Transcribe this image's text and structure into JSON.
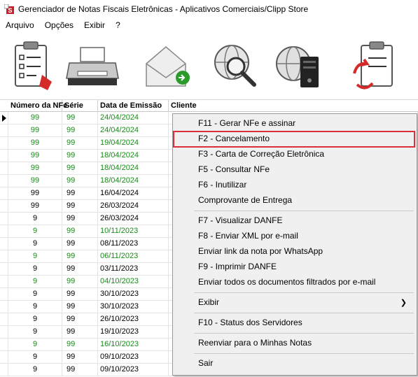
{
  "window": {
    "title": "Gerenciador de Notas Fiscais Eletrônicas - Aplicativos Comerciais/Clipp Store"
  },
  "menu": [
    "Arquivo",
    "Opções",
    "Exibir",
    "?"
  ],
  "toolbar": {
    "icons": [
      "clipboard-icon",
      "printer-icon",
      "envelope-icon",
      "globe-search-icon",
      "globe-server-icon",
      "clipboard-refresh-icon"
    ]
  },
  "grid": {
    "headers": [
      "Número da NFe",
      "Série",
      "Data de Emissão",
      "Cliente"
    ],
    "rows": [
      {
        "numero": "99",
        "serie": "99",
        "data": "24/04/2024",
        "color": "green"
      },
      {
        "numero": "99",
        "serie": "99",
        "data": "24/04/2024",
        "color": "green"
      },
      {
        "numero": "99",
        "serie": "99",
        "data": "19/04/2024",
        "color": "green"
      },
      {
        "numero": "99",
        "serie": "99",
        "data": "18/04/2024",
        "color": "green"
      },
      {
        "numero": "99",
        "serie": "99",
        "data": "18/04/2024",
        "color": "green"
      },
      {
        "numero": "99",
        "serie": "99",
        "data": "18/04/2024",
        "color": "green"
      },
      {
        "numero": "99",
        "serie": "99",
        "data": "16/04/2024",
        "color": "black"
      },
      {
        "numero": "99",
        "serie": "99",
        "data": "26/03/2024",
        "color": "black"
      },
      {
        "numero": "9",
        "serie": "99",
        "data": "26/03/2024",
        "color": "black"
      },
      {
        "numero": "9",
        "serie": "99",
        "data": "10/11/2023",
        "color": "green"
      },
      {
        "numero": "9",
        "serie": "99",
        "data": "08/11/2023",
        "color": "black"
      },
      {
        "numero": "9",
        "serie": "99",
        "data": "06/11/2023",
        "color": "green"
      },
      {
        "numero": "9",
        "serie": "99",
        "data": "03/11/2023",
        "color": "black"
      },
      {
        "numero": "9",
        "serie": "99",
        "data": "04/10/2023",
        "color": "green"
      },
      {
        "numero": "9",
        "serie": "99",
        "data": "30/10/2023",
        "color": "black"
      },
      {
        "numero": "9",
        "serie": "99",
        "data": "30/10/2023",
        "color": "black"
      },
      {
        "numero": "9",
        "serie": "99",
        "data": "26/10/2023",
        "color": "black"
      },
      {
        "numero": "9",
        "serie": "99",
        "data": "19/10/2023",
        "color": "black"
      },
      {
        "numero": "9",
        "serie": "99",
        "data": "16/10/2023",
        "color": "green"
      },
      {
        "numero": "9",
        "serie": "99",
        "data": "09/10/2023",
        "color": "black"
      },
      {
        "numero": "9",
        "serie": "99",
        "data": "09/10/2023",
        "color": "black"
      }
    ]
  },
  "context_menu": {
    "items": [
      "F11 - Gerar NFe e assinar",
      "F2 - Cancelamento",
      "F3 - Carta de Correção Eletrônica",
      "F5 - Consultar NFe",
      "F6 - Inutilizar",
      "Comprovante de Entrega",
      "F7 - Visualizar DANFE",
      "F8 - Enviar XML por e-mail",
      "Enviar link da nota por WhatsApp",
      "F9 - Imprimir DANFE",
      "Enviar todos os documentos filtrados por e-mail",
      "Exibir",
      "F10 - Status dos Servidores",
      "Reenviar para o Minhas Notas",
      "Sair"
    ],
    "highlighted": "F2 - Cancelamento",
    "highlight_color": "#d9303a"
  },
  "colors": {
    "status_green": "#1a8a1a"
  }
}
